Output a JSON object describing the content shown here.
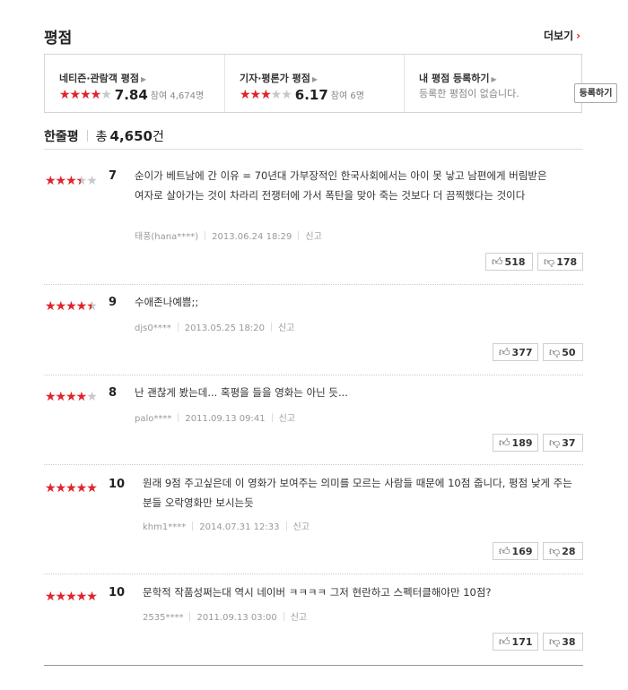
{
  "section": {
    "title": "평점",
    "more_label": "더보기"
  },
  "ratings": {
    "netizen": {
      "label": "네티즌·관람객 평점",
      "stars": 4,
      "score": "7.84",
      "count": "참여 4,674명"
    },
    "critic": {
      "label": "기자·평론가 평점",
      "stars": 3,
      "score": "6.17",
      "count": "참여 6명"
    },
    "mine": {
      "label": "내 평점 등록하기",
      "sub": "등록한 평점이 없습니다.",
      "button": "등록하기"
    }
  },
  "comments_header": {
    "label": "한줄평",
    "total_prefix": "총",
    "total": "4,650",
    "unit": "건"
  },
  "reviews": [
    {
      "score": "7",
      "stars": 3.5,
      "text": "순이가 베트남에 간 이유 = 70년대 가부장적인 한국사회에서는 아이 못 낳고 남편에게 버림받은 여자로 살아가는 것이 차라리 전쟁터에 가서 폭탄을 맞아 죽는 것보다 더 끔찍했다는 것이다",
      "user": "태풍(hana****)",
      "date": "2013.06.24 18:29",
      "report": "신고",
      "likes": "518",
      "dislikes": "178"
    },
    {
      "score": "9",
      "stars": 4.5,
      "text": "수애존나예쁨;;",
      "user": "djs0****",
      "date": "2013.05.25 18:20",
      "report": "신고",
      "likes": "377",
      "dislikes": "50"
    },
    {
      "score": "8",
      "stars": 4,
      "text": "난 괜찮게 봤는데... 혹평을 들을 영화는 아닌 듯...",
      "user": "palo****",
      "date": "2011.09.13 09:41",
      "report": "신고",
      "likes": "189",
      "dislikes": "37"
    },
    {
      "score": "10",
      "stars": 5,
      "text": "원래 9점 주고싶은데 이 영화가 보여주는 의미를 모르는 사람들 때문에 10점 줍니다, 평점 낮게 주는 분들 오락영화만 보시는듯",
      "user": "khm1****",
      "date": "2014.07.31 12:33",
      "report": "신고",
      "likes": "169",
      "dislikes": "28"
    },
    {
      "score": "10",
      "stars": 5,
      "text": "문학적 작품성쩌는대 역시 네이버 ㅋㅋㅋㅋ 그저 현란하고 스펙터클해야만 10점?",
      "user": "2535****",
      "date": "2011.09.13 03:00",
      "report": "신고",
      "likes": "171",
      "dislikes": "38"
    }
  ]
}
